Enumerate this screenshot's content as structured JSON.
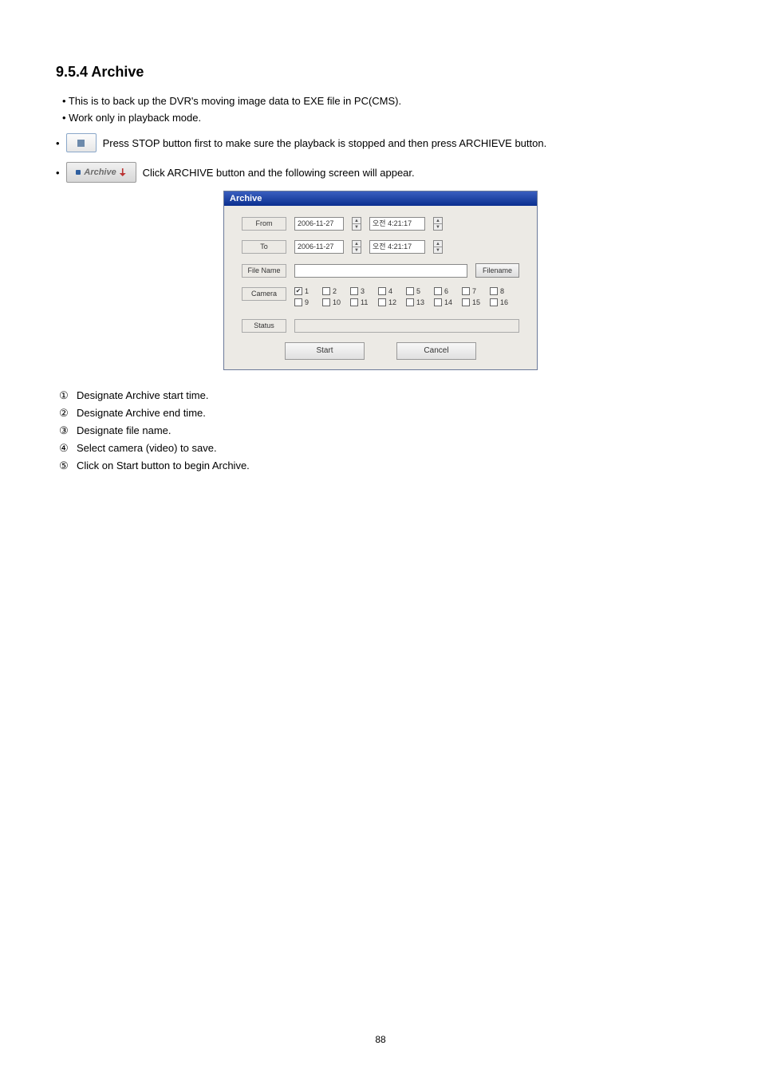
{
  "heading": "9.5.4  Archive",
  "intro1": "• This is to back up the DVR's moving image data to EXE file in PC(CMS).",
  "intro2": "• Work only in playback mode.",
  "stop_line_prefix": "•",
  "stop_line_text": " Press STOP button first to make sure the playback is stopped and then press ARCHIEVE button.",
  "archive_btn_label": "Archive",
  "archive_line_prefix": "•",
  "archive_line_text": " Click ARCHIVE button and the following screen will appear.",
  "dialog": {
    "title": "Archive",
    "from_label": "From",
    "from_date": "2006-11-27",
    "from_time_prefix": "오전",
    "from_time": "4:21:17",
    "to_label": "To",
    "to_date": "2006-11-27",
    "to_time_prefix": "오전",
    "to_time": "4:21:17",
    "filename_label": "File Name",
    "filename_btn": "Filename",
    "camera_label": "Camera",
    "cameras": [
      {
        "n": "1",
        "checked": true
      },
      {
        "n": "2",
        "checked": false
      },
      {
        "n": "3",
        "checked": false
      },
      {
        "n": "4",
        "checked": false
      },
      {
        "n": "5",
        "checked": false
      },
      {
        "n": "6",
        "checked": false
      },
      {
        "n": "7",
        "checked": false
      },
      {
        "n": "8",
        "checked": false
      },
      {
        "n": "9",
        "checked": false
      },
      {
        "n": "10",
        "checked": false
      },
      {
        "n": "11",
        "checked": false
      },
      {
        "n": "12",
        "checked": false
      },
      {
        "n": "13",
        "checked": false
      },
      {
        "n": "14",
        "checked": false
      },
      {
        "n": "15",
        "checked": false
      },
      {
        "n": "16",
        "checked": false
      }
    ],
    "status_label": "Status",
    "start_btn": "Start",
    "cancel_btn": "Cancel"
  },
  "steps": [
    {
      "num": "①",
      "text": "Designate Archive start time."
    },
    {
      "num": "②",
      "text": "Designate Archive end time."
    },
    {
      "num": "③",
      "text": "Designate file name."
    },
    {
      "num": "④",
      "text": "Select camera (video) to save."
    },
    {
      "num": "⑤",
      "text": "Click on Start button to begin Archive."
    }
  ],
  "page_number": "88"
}
